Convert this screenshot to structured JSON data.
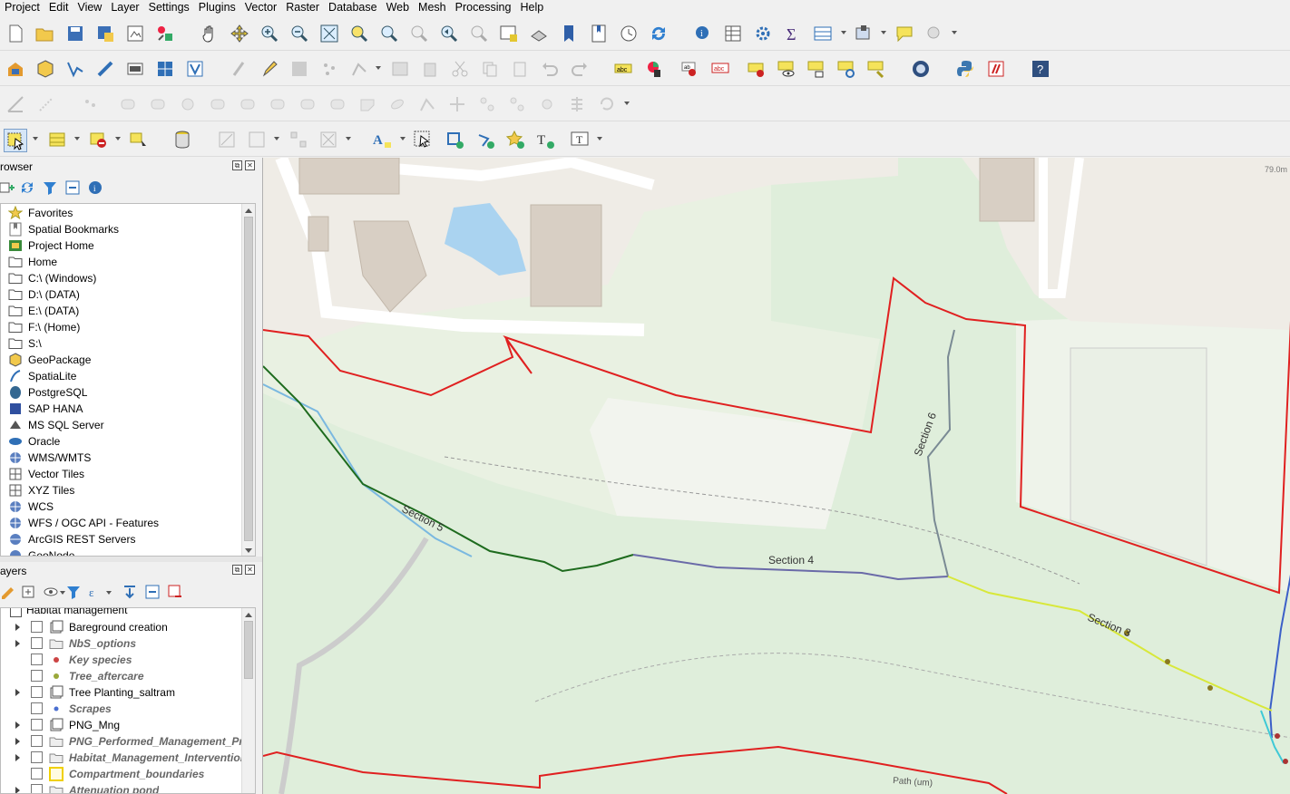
{
  "menubar": {
    "items": [
      "Project",
      "Edit",
      "View",
      "Layer",
      "Settings",
      "Plugins",
      "Vector",
      "Raster",
      "Database",
      "Web",
      "Mesh",
      "Processing",
      "Help"
    ]
  },
  "toolbars": {
    "row1_icons": [
      "new-project-icon",
      "open-project-icon",
      "save-project-icon",
      "save-as-icon",
      "print-layout-icon",
      "style-manager-icon",
      "pan-icon",
      "pan-to-selection-icon",
      "zoom-in-icon",
      "zoom-out-icon",
      "zoom-full-icon",
      "zoom-to-selection-icon",
      "zoom-to-layer-icon",
      "zoom-native-icon",
      "zoom-last-icon",
      "zoom-next-icon",
      "new-map-view-icon",
      "new-3d-map-icon",
      "new-bookmark-icon",
      "show-bookmarks-icon",
      "temporal-controller-icon",
      "refresh-icon",
      "identify-icon",
      "open-attribute-table-icon",
      "toolbox-icon",
      "statistics-icon",
      "field-calculator-icon",
      "select-layout-icon",
      "map-tips-icon",
      "measure-icon"
    ],
    "row2_icons": [
      "data-source-manager-icon",
      "new-geopackage-layer-icon",
      "new-shapefile-layer-icon",
      "new-temporary-layer-icon",
      "new-virtual-layer-icon",
      "raster-calc-icon",
      "vector-tiles-icon",
      "digitize-icon",
      "toggle-editing-icon",
      "save-edits-icon",
      "add-feature-icon",
      "vertex-tool-icon",
      "modify-attributes-icon",
      "delete-selected-icon",
      "cut-features-icon",
      "copy-features-icon",
      "paste-features-icon",
      "undo-icon",
      "redo-icon",
      "label-tool-icon",
      "diagram-tool-icon",
      "pin-labels-icon",
      "highlight-pinned-icon",
      "move-label-icon",
      "show-hide-labels-icon",
      "rotate-label-icon",
      "change-label-icon",
      "label-properties-icon",
      "qgis-cloud-icon",
      "python-console-icon",
      "processing-icon",
      "help-icon"
    ],
    "row4_icons": [
      "select-features-icon",
      "select-by-value-icon",
      "deselect-icon",
      "select-location-icon",
      "database-icon",
      "georeferencer-icon",
      "raster-align-icon",
      "plugin-icon",
      "spatial-query-icon",
      "annotation-text-icon",
      "select-annotation-icon",
      "create-polygon-icon",
      "create-line-icon",
      "create-point-icon",
      "create-marker-icon",
      "text-annotation-icon"
    ]
  },
  "browser": {
    "title": "rowser",
    "items": [
      {
        "label": "Favorites",
        "icon": "star-icon"
      },
      {
        "label": "Spatial Bookmarks",
        "icon": "bookmark-icon"
      },
      {
        "label": "Project Home",
        "icon": "project-home-icon"
      },
      {
        "label": "Home",
        "icon": "folder-icon"
      },
      {
        "label": "C:\\ (Windows)",
        "icon": "folder-icon"
      },
      {
        "label": "D:\\ (DATA)",
        "icon": "folder-icon"
      },
      {
        "label": "E:\\ (DATA)",
        "icon": "folder-icon"
      },
      {
        "label": "F:\\ (Home)",
        "icon": "folder-icon"
      },
      {
        "label": "S:\\",
        "icon": "folder-icon"
      },
      {
        "label": "GeoPackage",
        "icon": "geopackage-icon"
      },
      {
        "label": "SpatiaLite",
        "icon": "spatialite-icon"
      },
      {
        "label": "PostgreSQL",
        "icon": "postgresql-icon"
      },
      {
        "label": "SAP HANA",
        "icon": "sap-hana-icon"
      },
      {
        "label": "MS SQL Server",
        "icon": "mssql-icon"
      },
      {
        "label": "Oracle",
        "icon": "oracle-icon"
      },
      {
        "label": "WMS/WMTS",
        "icon": "wms-icon"
      },
      {
        "label": "Vector Tiles",
        "icon": "vector-tiles-icon"
      },
      {
        "label": "XYZ Tiles",
        "icon": "xyz-tiles-icon"
      },
      {
        "label": "WCS",
        "icon": "wcs-icon"
      },
      {
        "label": "WFS / OGC API - Features",
        "icon": "wfs-icon"
      },
      {
        "label": "ArcGIS REST Servers",
        "icon": "arcgis-icon"
      },
      {
        "label": "GeoNode",
        "icon": "geonode-icon"
      }
    ]
  },
  "layers": {
    "title": "ayers",
    "group": "Habitat management",
    "items": [
      {
        "label": "Bareground creation",
        "italic": false,
        "expander": true,
        "icon": "group-icon"
      },
      {
        "label": "NbS_options",
        "italic": true,
        "expander": true,
        "icon": "group-folder-icon"
      },
      {
        "label": "Key species",
        "italic": true,
        "expander": false,
        "icon": "point-red-icon"
      },
      {
        "label": "Tree_aftercare",
        "italic": true,
        "expander": false,
        "icon": "point-olive-icon"
      },
      {
        "label": "Tree Planting_saltram",
        "italic": false,
        "expander": true,
        "icon": "group-icon"
      },
      {
        "label": "Scrapes",
        "italic": true,
        "expander": false,
        "icon": "point-blue-icon"
      },
      {
        "label": "PNG_Mng",
        "italic": false,
        "expander": true,
        "icon": "group-icon"
      },
      {
        "label": "PNG_Performed_Management_Pre",
        "italic": true,
        "expander": true,
        "icon": "group-folder-icon"
      },
      {
        "label": "Habitat_Management_Intervention",
        "italic": true,
        "expander": true,
        "icon": "group-folder-icon"
      },
      {
        "label": "Compartment_boundaries",
        "italic": true,
        "expander": false,
        "icon": "polygon-yellow-icon"
      },
      {
        "label": "Attenuation pond",
        "italic": true,
        "expander": true,
        "icon": "group-folder-icon"
      }
    ]
  },
  "map": {
    "scale_readout": "79.0m",
    "labels": {
      "section3": "Section 3",
      "section4": "Section 4",
      "section5": "Section 5",
      "section6": "Section 6",
      "path": "Path (um)"
    },
    "colors": {
      "boundary": "#e02020",
      "section5": "#1e6b1e",
      "section4": "#6a6aa8",
      "section6": "#7a8a94",
      "section3": "#d8e83a",
      "stream": "#7ab8e0",
      "woodland": "#cfe5c8",
      "grass": "#dfeedb",
      "building": "#d8cfc4",
      "water": "#aad3f0"
    }
  }
}
